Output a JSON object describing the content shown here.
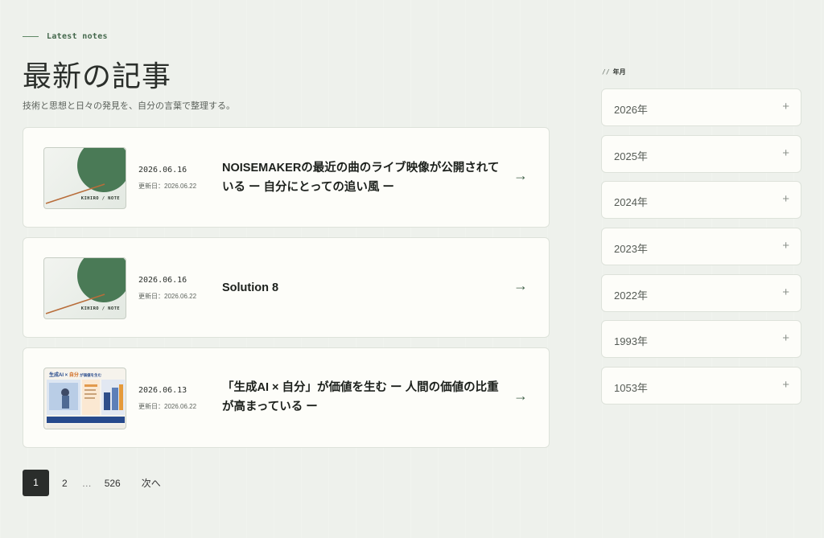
{
  "header": {
    "eyebrow": "Latest notes",
    "title": "最新の記事",
    "lead": "技術と思想と日々の発見を、自分の言葉で整理する。"
  },
  "posts": [
    {
      "date": "2026.06.16",
      "updated": "更新日：2026.06.22",
      "title": "NOISEMAKERの最近の曲のライブ映像が公開されている ー 自分にとっての追い風 ー",
      "thumb_tag": "KIHIRO / NOTE",
      "arrow": "→"
    },
    {
      "date": "2026.06.16",
      "updated": "更新日：2026.06.22",
      "title": "Solution 8",
      "thumb_tag": "KIHIRO / NOTE",
      "arrow": "→"
    },
    {
      "date": "2026.06.13",
      "updated": "更新日：2026.06.22",
      "title": "「生成AI × 自分」が価値を生む ー 人間の価値の比重が高まっている ー",
      "thumb_head_a": "生成AI × ",
      "thumb_head_b": "自分",
      "thumb_head_c": " が価値を生む",
      "arrow": "→"
    }
  ],
  "pagination": {
    "current": "1",
    "next_page": "2",
    "ellipsis": "…",
    "last": "526",
    "next_label": "次へ"
  },
  "sidebar": {
    "prefix": "//",
    "heading": "年月",
    "years": [
      "2026年",
      "2025年",
      "2024年",
      "2023年",
      "2022年",
      "1993年",
      "1053年"
    ],
    "expand_symbol": "+"
  },
  "colors": {
    "background": "#eef1ec",
    "accent_green": "#44684c",
    "thumb_circle": "#4a7a56",
    "thumb_line": "#b86d3a",
    "pager_active": "#2a2d2b"
  }
}
